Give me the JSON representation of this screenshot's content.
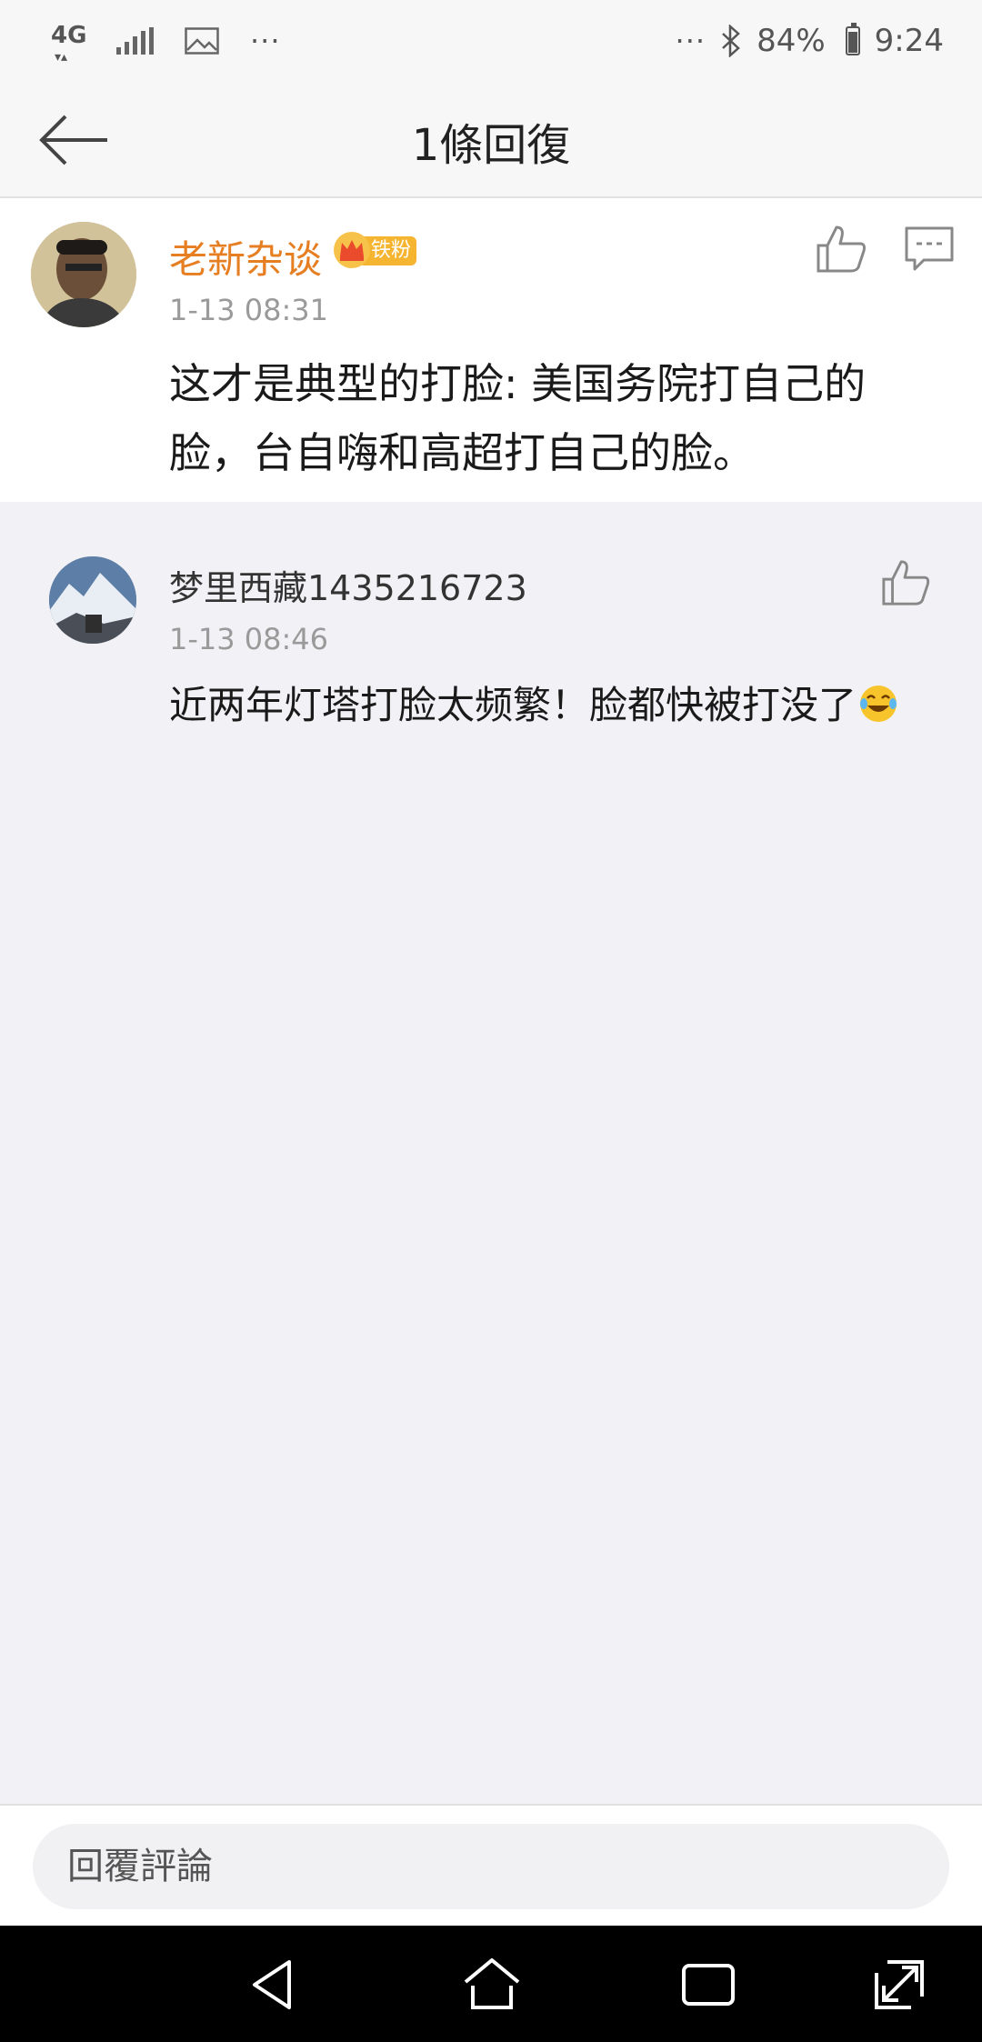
{
  "status_bar": {
    "network": "4G",
    "dots_left": "···",
    "dots_right": "···",
    "battery": "84%",
    "time": "9:24",
    "battery_level": 0.84
  },
  "header": {
    "title": "1條回復"
  },
  "main_comment": {
    "username": "老新杂谈",
    "badge": "铁粉",
    "time": "1-13 08:31",
    "text": "这才是典型的打脸: 美国务院打自己的脸，台自嗨和高超打自己的脸。"
  },
  "reply": {
    "username": "梦里西藏1435216723",
    "time": "1-13 08:46",
    "text": "近两年灯塔打脸太频繁！脸都快被打没了"
  },
  "input": {
    "placeholder": "回覆評論"
  },
  "colors": {
    "username_accent": "#e67e22",
    "badge": "#f6b531",
    "background": "#f2f2f6"
  },
  "icons": [
    "back-arrow-icon",
    "thumbs-up-icon",
    "comment-icon",
    "nav-back-icon",
    "nav-home-icon",
    "nav-recents-icon",
    "nav-expand-icon"
  ]
}
